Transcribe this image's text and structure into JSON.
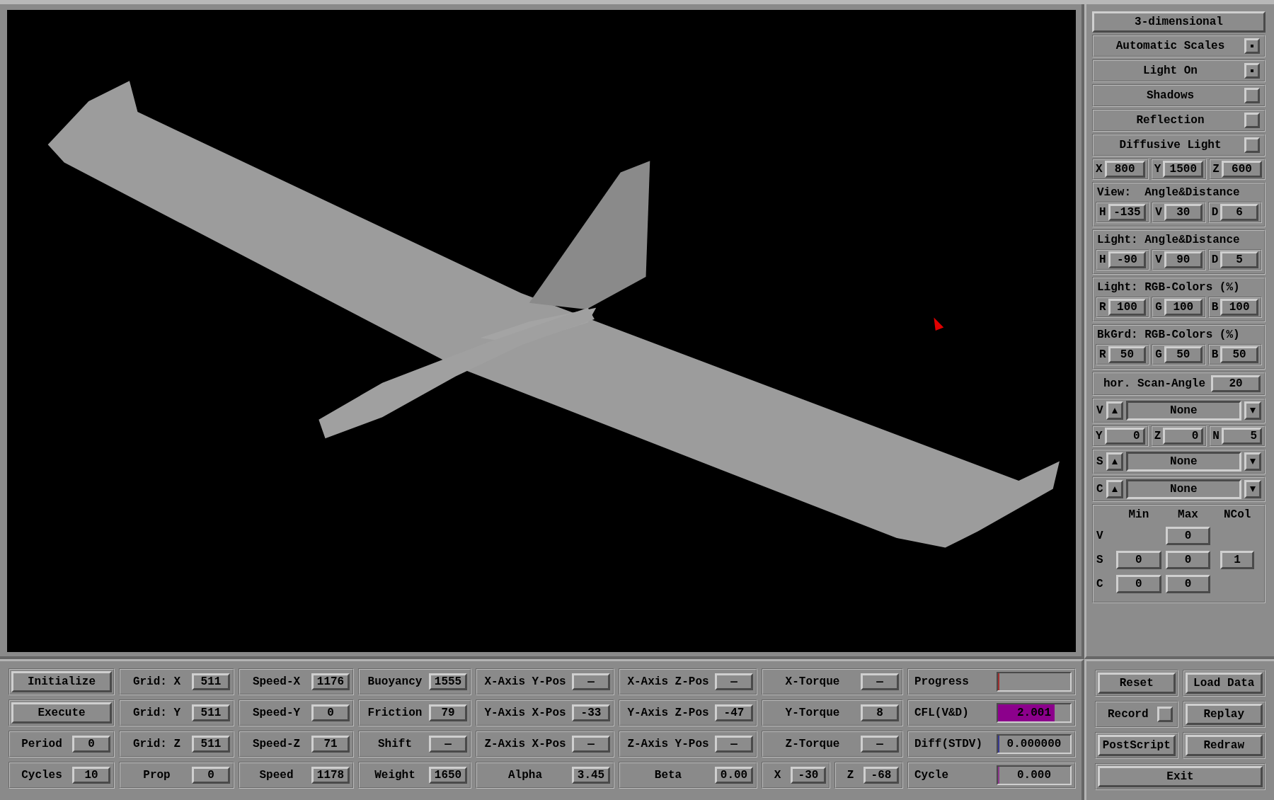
{
  "side_panel": [
    {
      "kind": "button",
      "label": "3-dimensional"
    },
    {
      "kind": "toggle",
      "label": "Automatic Scales",
      "checked": true
    },
    {
      "kind": "toggle",
      "label": "Light On",
      "checked": true
    },
    {
      "kind": "toggle",
      "label": "Shadows",
      "checked": false
    },
    {
      "kind": "toggle",
      "label": "Reflection",
      "checked": false
    },
    {
      "kind": "toggle",
      "label": "Diffusive Light",
      "checked": false
    },
    {
      "kind": "triple",
      "fields": [
        {
          "label": "X",
          "value": "800"
        },
        {
          "label": "Y",
          "value": "1500"
        },
        {
          "label": "Z",
          "value": "600"
        }
      ]
    },
    {
      "kind": "group",
      "title": "View:  Angle&Distance",
      "fields": [
        {
          "label": "H",
          "value": "-135"
        },
        {
          "label": "V",
          "value": "30"
        },
        {
          "label": "D",
          "value": "6"
        }
      ]
    },
    {
      "kind": "group",
      "title": "Light: Angle&Distance",
      "fields": [
        {
          "label": "H",
          "value": "-90"
        },
        {
          "label": "V",
          "value": "90"
        },
        {
          "label": "D",
          "value": "5"
        }
      ]
    },
    {
      "kind": "group",
      "title": "Light: RGB-Colors (%)",
      "fields": [
        {
          "label": "R",
          "value": "100"
        },
        {
          "label": "G",
          "value": "100"
        },
        {
          "label": "B",
          "value": "100"
        }
      ]
    },
    {
      "kind": "group",
      "title": "BkGrd: RGB-Colors (%)",
      "fields": [
        {
          "label": "R",
          "value": "50"
        },
        {
          "label": "G",
          "value": "50"
        },
        {
          "label": "B",
          "value": "50"
        }
      ]
    },
    {
      "kind": "field",
      "label": "hor. Scan-Angle",
      "value": "20"
    },
    {
      "kind": "selector",
      "label": "V",
      "value": "None"
    },
    {
      "kind": "numeric_triple",
      "fields": [
        {
          "label": "Y",
          "value": "0"
        },
        {
          "label": "Z",
          "value": "0"
        },
        {
          "label": "N",
          "value": "5"
        }
      ]
    },
    {
      "kind": "selector",
      "label": "S",
      "value": "None"
    },
    {
      "kind": "selector",
      "label": "C",
      "value": "None"
    },
    {
      "kind": "range_table",
      "columns": [
        "Min",
        "Max",
        "NCol"
      ],
      "rows": [
        {
          "label": "V",
          "cells": [
            null,
            "0",
            null
          ]
        },
        {
          "label": "S",
          "cells": [
            "0",
            "0",
            "1"
          ]
        },
        {
          "label": "C",
          "cells": [
            "0",
            "0",
            null
          ]
        }
      ]
    }
  ],
  "control_rows": [
    [
      {
        "kind": "button",
        "label": "Initialize"
      },
      {
        "kind": "field",
        "label": "Grid: X",
        "value": "511"
      },
      {
        "kind": "field",
        "label": "Speed-X",
        "value": "1176"
      },
      {
        "kind": "field",
        "label": "Buoyancy",
        "value": "1555"
      },
      {
        "kind": "field",
        "label": "X-Axis Y-Pos",
        "value": "—"
      },
      {
        "kind": "field",
        "label": "X-Axis Z-Pos",
        "value": "—"
      },
      {
        "kind": "field",
        "label": "X-Torque",
        "value": "—"
      },
      {
        "kind": "meter",
        "label": "Progress",
        "level": 0,
        "color": "#a03030"
      }
    ],
    [
      {
        "kind": "button",
        "label": "Execute"
      },
      {
        "kind": "field",
        "label": "Grid: Y",
        "value": "511"
      },
      {
        "kind": "field",
        "label": "Speed-Y",
        "value": "0"
      },
      {
        "kind": "field",
        "label": "Friction",
        "value": "79"
      },
      {
        "kind": "field",
        "label": "Y-Axis X-Pos",
        "value": "-33"
      },
      {
        "kind": "field",
        "label": "Y-Axis Z-Pos",
        "value": "-47"
      },
      {
        "kind": "field",
        "label": "Y-Torque",
        "value": "8"
      },
      {
        "kind": "meter",
        "label": "CFL(V&D)",
        "value": "2.001",
        "level": 0.78,
        "color": "#8c008c"
      }
    ],
    [
      {
        "kind": "field",
        "label": "Period",
        "value": "0"
      },
      {
        "kind": "field",
        "label": "Grid: Z",
        "value": "511"
      },
      {
        "kind": "field",
        "label": "Speed-Z",
        "value": "71"
      },
      {
        "kind": "field",
        "label": "Shift",
        "value": "—"
      },
      {
        "kind": "field",
        "label": "Z-Axis X-Pos",
        "value": "—"
      },
      {
        "kind": "field",
        "label": "Z-Axis Y-Pos",
        "value": "—"
      },
      {
        "kind": "field",
        "label": "Z-Torque",
        "value": "—"
      },
      {
        "kind": "meter",
        "label": "Diff(STDV)",
        "value": "0.000000",
        "level": 0,
        "color": "#3a3a90"
      }
    ],
    [
      {
        "kind": "field",
        "label": "Cycles",
        "value": "10"
      },
      {
        "kind": "field",
        "label": "Prop",
        "value": "0"
      },
      {
        "kind": "field",
        "label": "Speed",
        "value": "1178"
      },
      {
        "kind": "field",
        "label": "Weight",
        "value": "1650"
      },
      {
        "kind": "field",
        "label": "Alpha",
        "value": "3.45"
      },
      {
        "kind": "field",
        "label": "Beta",
        "value": "0.00"
      },
      {
        "kind": "pair",
        "fields": [
          {
            "label": "X",
            "value": "-30"
          },
          {
            "label": "Z",
            "value": "-68"
          }
        ]
      },
      {
        "kind": "meter",
        "label": "Cycle",
        "value": "0.000",
        "level": 0,
        "color": "#8c3a8c"
      }
    ]
  ],
  "action_buttons": [
    {
      "kind": "button",
      "label": "Reset"
    },
    {
      "kind": "button",
      "label": "Load Data"
    },
    {
      "kind": "toggle",
      "label": "Record",
      "checked": false
    },
    {
      "kind": "button",
      "label": "Replay"
    },
    {
      "kind": "button",
      "label": "PostScript"
    },
    {
      "kind": "button",
      "label": "Redraw"
    },
    {
      "kind": "wide_button",
      "label": "Exit"
    }
  ]
}
